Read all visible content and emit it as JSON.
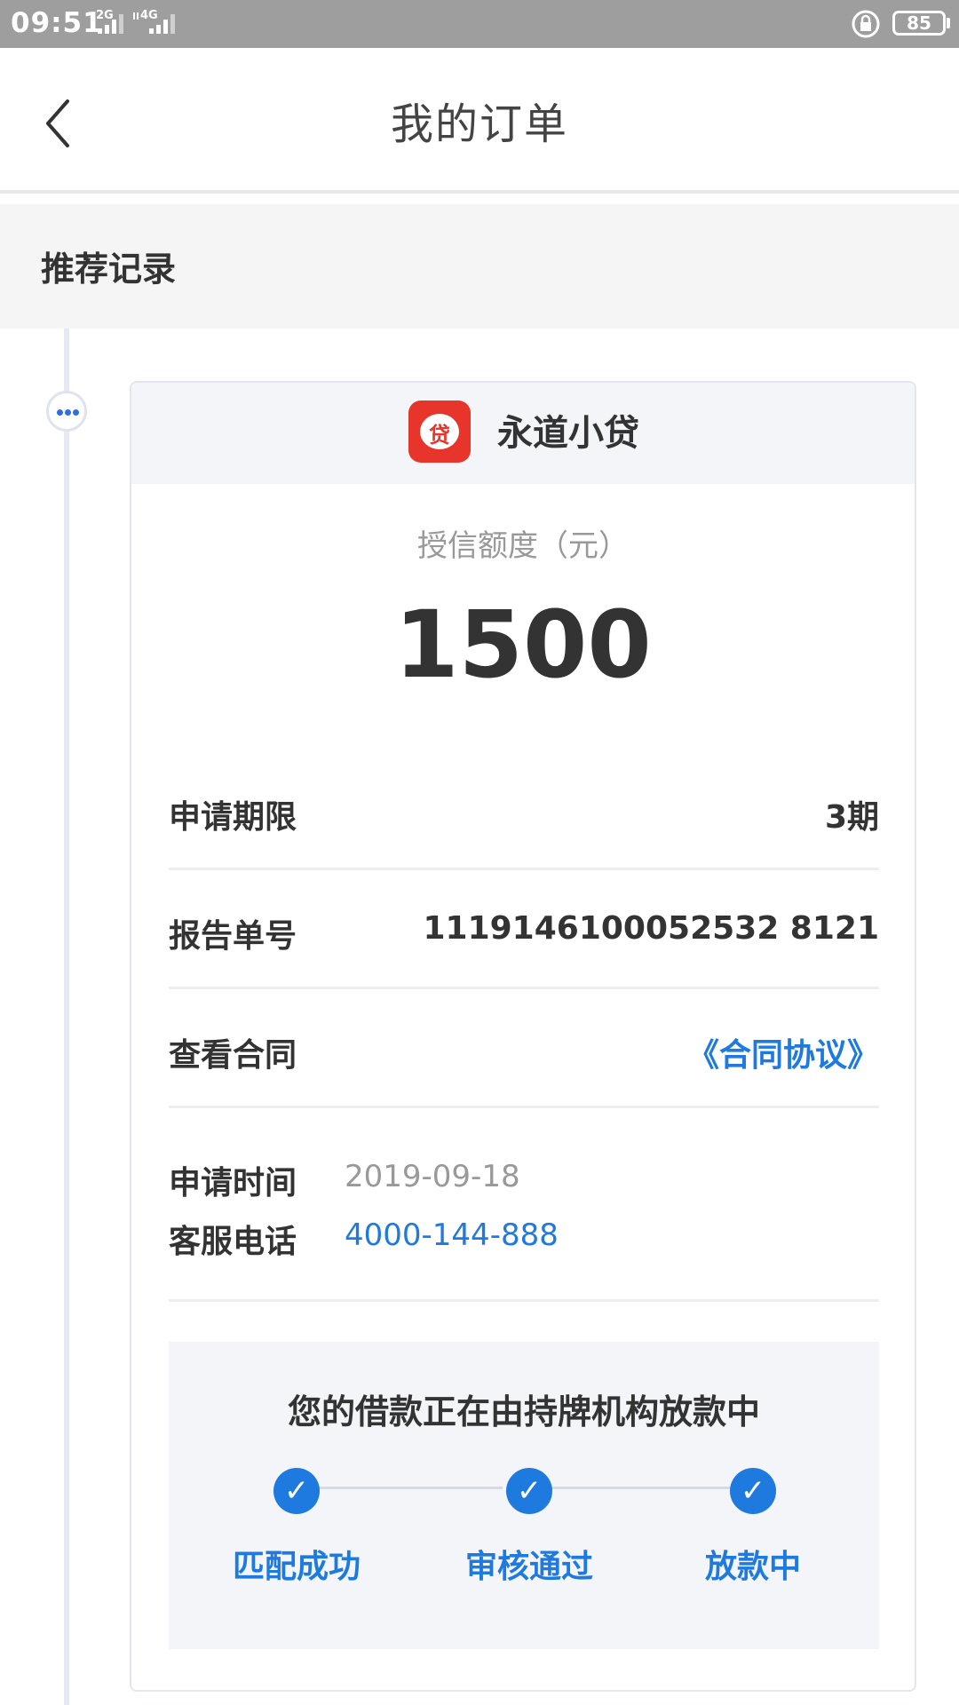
{
  "status_bar": {
    "time": "09:51",
    "net1": "2G",
    "net2": "4G",
    "net2_prefix": "4‡",
    "battery": "85"
  },
  "header": {
    "title": "我的订单",
    "back_icon": "chevron-left-icon"
  },
  "section": {
    "title": "推荐记录"
  },
  "card": {
    "lender_name": "永道小贷",
    "lender_logo_char": "贷",
    "credit_label": "授信额度（元）",
    "credit_value": "1500",
    "rows": [
      {
        "label": "申请期限",
        "value": "3期"
      },
      {
        "label": "报告单号",
        "value": "1119146100052532 8121"
      },
      {
        "label": "查看合同",
        "value": "《合同协议》"
      }
    ],
    "apply_time_label": "申请时间",
    "apply_time_value": "2019-09-18",
    "service_label": "客服电话",
    "service_value": "4000-144-888",
    "status_message": "您的借款正在由持牌机构放款中",
    "steps": [
      {
        "label": "匹配成功",
        "icon": "check-circle-icon"
      },
      {
        "label": "审核通过",
        "icon": "check-circle-icon"
      },
      {
        "label": "放款中",
        "icon": "check-circle-icon"
      }
    ]
  },
  "colors": {
    "accent": "#1f7ae0",
    "logo": "#e8352b",
    "status_bar": "#9e9e9e"
  }
}
